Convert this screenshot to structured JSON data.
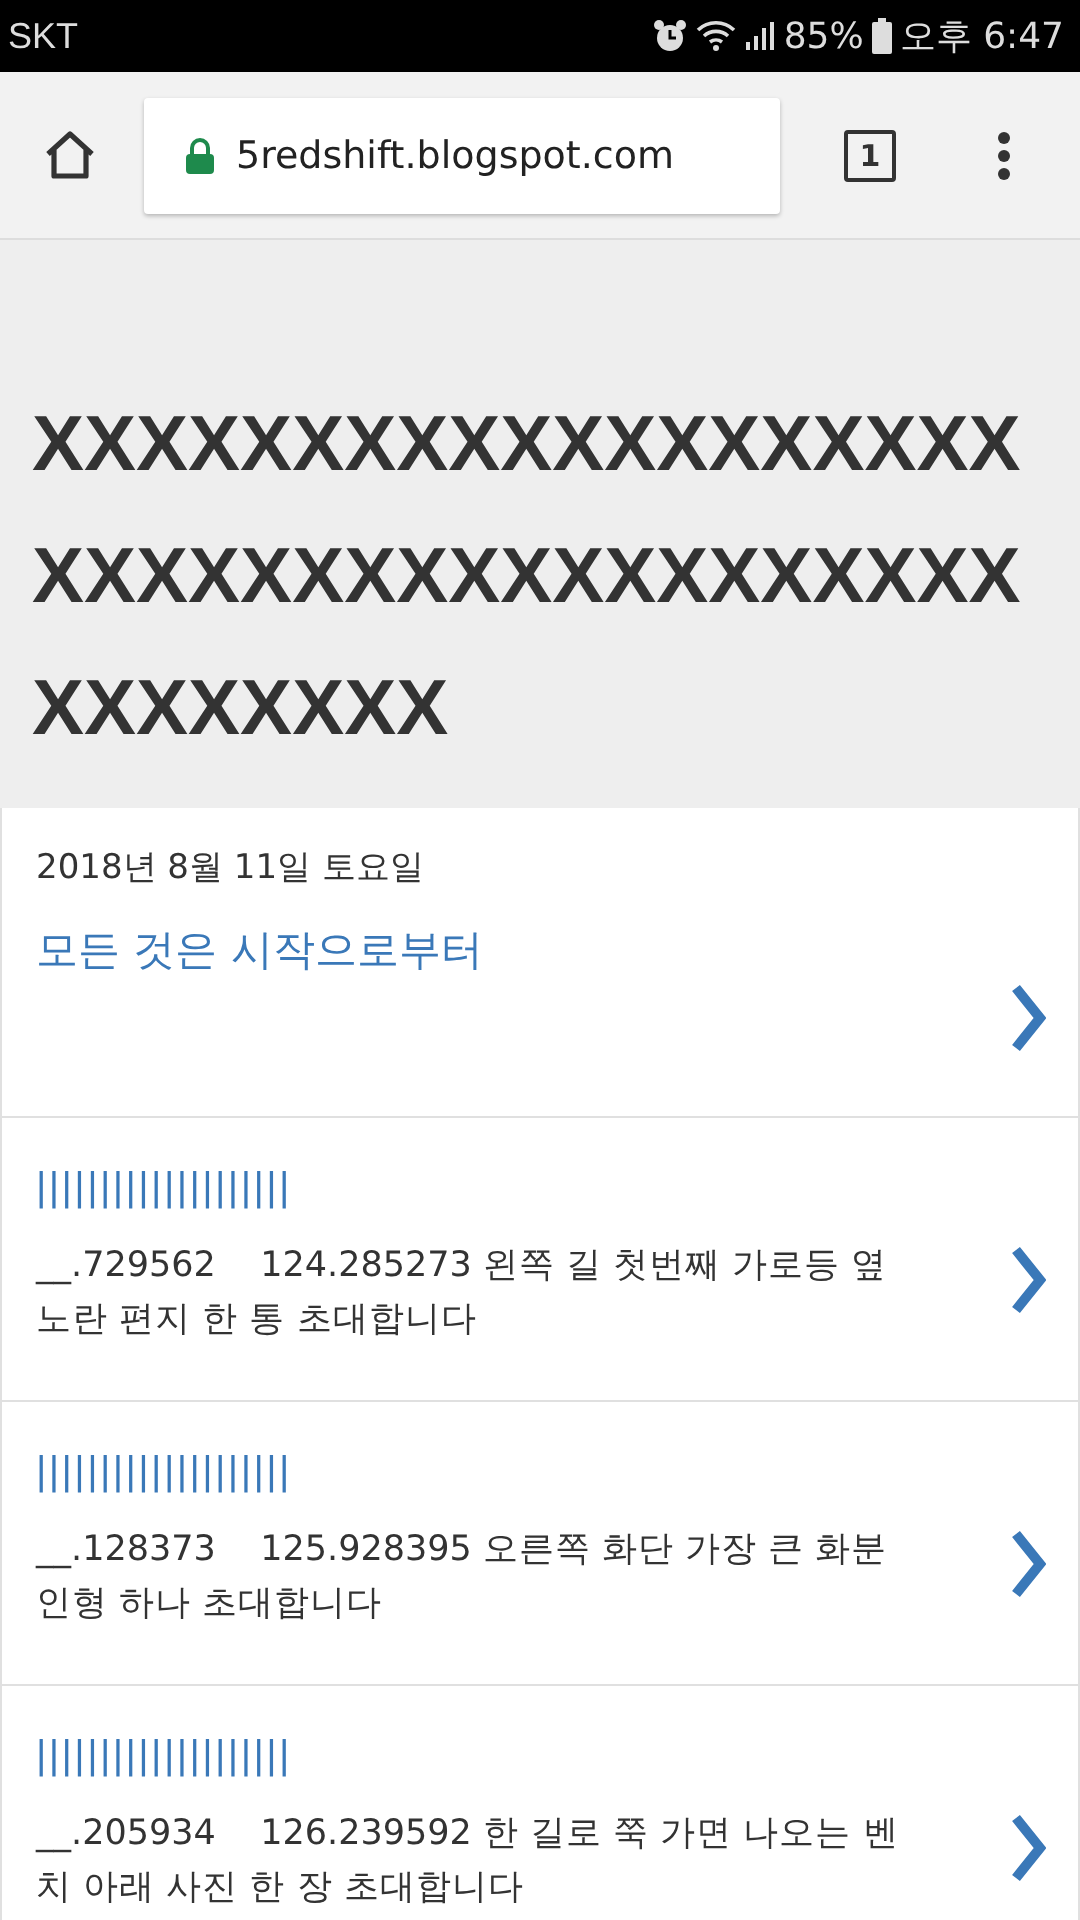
{
  "status_bar": {
    "carrier": "SKT",
    "battery": "85%",
    "time": "오후 6:47"
  },
  "browser": {
    "url": "5redshift.blogspot.com",
    "tab_count": "1"
  },
  "blog": {
    "title": "XXXXXXXXXXXXXXXXXXXXXXXXXXXXXXXXXXXXXXXXXXXXXX"
  },
  "posts": [
    {
      "kind": "dated",
      "date": "2018년 8월 11일 토요일",
      "title": "모든 것은 시작으로부터"
    },
    {
      "kind": "snippet",
      "title": "||||||||||||||||||||",
      "text": "__.729562    124.285273 왼쪽 길 첫번째 가로등 옆 노란 편지 한 통 초대합니다"
    },
    {
      "kind": "snippet",
      "title": "||||||||||||||||||||",
      "text": "__.128373    125.928395 오른쪽 화단 가장 큰 화분 인형 하나 초대합니다"
    },
    {
      "kind": "snippet",
      "title": "||||||||||||||||||||",
      "text": "__.205934    126.239592 한 길로 쭉 가면 나오는 벤치 아래 사진 한 장 초대합니다"
    }
  ]
}
